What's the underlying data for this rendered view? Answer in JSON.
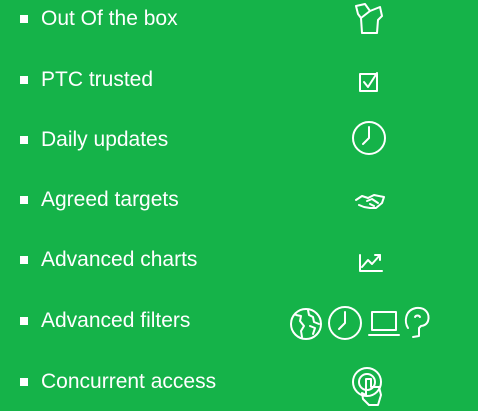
{
  "features": [
    {
      "label": "Out Of the box",
      "icons": [
        "open-box-icon"
      ]
    },
    {
      "label": "PTC trusted",
      "icons": [
        "checkbox-icon"
      ]
    },
    {
      "label": "Daily updates",
      "icons": [
        "clock-icon"
      ]
    },
    {
      "label": "Agreed targets",
      "icons": [
        "handshake-icon"
      ]
    },
    {
      "label": "Advanced charts",
      "icons": [
        "trend-chart-icon"
      ]
    },
    {
      "label": "Advanced filters",
      "icons": [
        "globe-icon",
        "clock-icon",
        "laptop-icon",
        "head-icon"
      ]
    },
    {
      "label": "Concurrent access",
      "icons": [
        "touch-icon"
      ]
    }
  ],
  "colors": {
    "background": "#15B349",
    "foreground": "#FFFFFF"
  }
}
